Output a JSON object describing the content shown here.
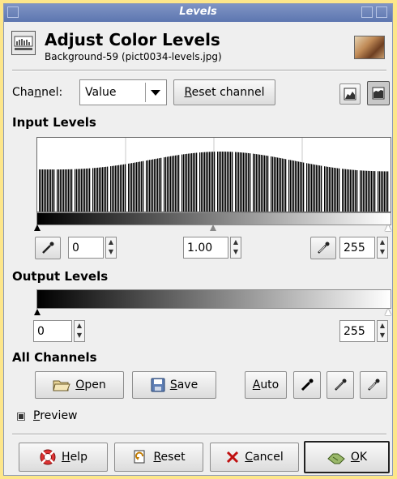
{
  "window": {
    "title": "Levels"
  },
  "header": {
    "title": "Adjust Color Levels",
    "subtitle": "Background-59 (pict0034-levels.jpg)"
  },
  "channel": {
    "label_pre": "Cha",
    "label_ul": "n",
    "label_post": "nel:",
    "value": "Value",
    "reset_pre": "R",
    "reset_post": "eset channel"
  },
  "input": {
    "heading": "Input Levels",
    "low": "0",
    "gamma": "1.00",
    "high": "255"
  },
  "output": {
    "heading": "Output Levels",
    "low": "0",
    "high": "255"
  },
  "all": {
    "heading": "All Channels",
    "open_ul": "O",
    "open_rest": "pen",
    "save_ul": "S",
    "save_rest": "ave",
    "auto_ul": "A",
    "auto_rest": "uto"
  },
  "preview": {
    "ul": "P",
    "rest": "review"
  },
  "footer": {
    "help_ul": "H",
    "help_rest": "elp",
    "reset_ul": "R",
    "reset_rest": "eset",
    "cancel_ul": "C",
    "cancel_rest": "ancel",
    "ok_ul": "O",
    "ok_rest": "K"
  },
  "colors": {
    "titlebar": "#6b82ba",
    "background": "#efefef",
    "desktop": "#fde68a"
  }
}
